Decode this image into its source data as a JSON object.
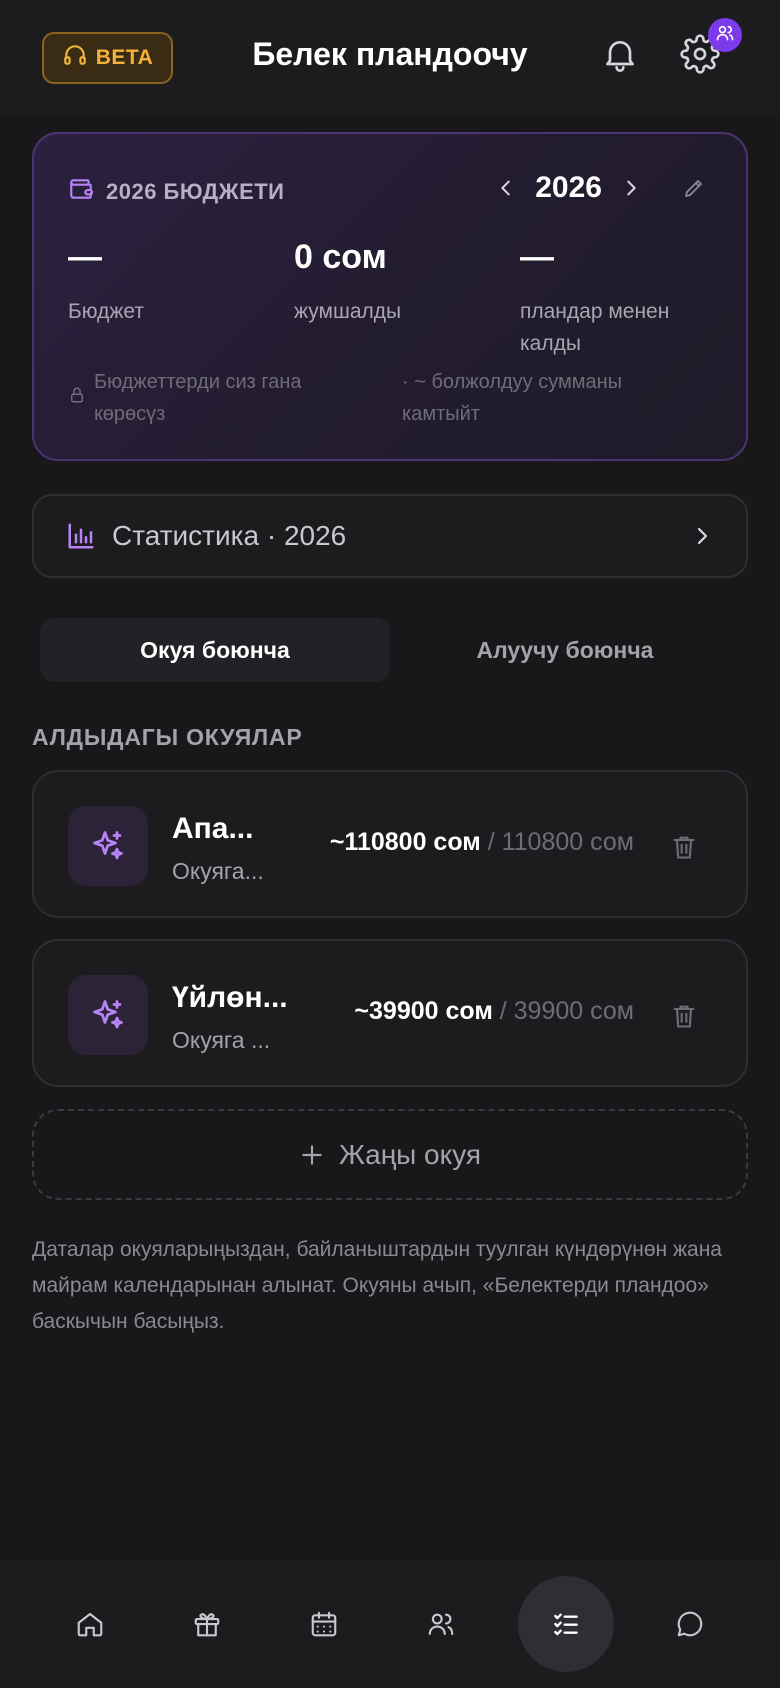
{
  "header": {
    "beta_label": "BETA",
    "title": "Белек пландоочу",
    "icons": [
      "headphones-icon",
      "bell-icon",
      "gear-icon",
      "users-icon"
    ]
  },
  "budget": {
    "heading": "2026 БЮДЖЕТИ",
    "year": "2026",
    "stats": [
      {
        "value": "—",
        "label": "Бюджет"
      },
      {
        "value": "0 сом",
        "label": "жумшалды"
      },
      {
        "value": "—",
        "label": "пландар менен калды"
      }
    ],
    "note_private": "Бюджеттерди сиз гана көрөсүз",
    "note_approx": "· ~ болжолдуу сумманы камтыйт"
  },
  "statistics": {
    "label": "Статистика · 2026"
  },
  "tabs": {
    "by_event": "Окуя боюнча",
    "by_recipient": "Алуучу боюнча"
  },
  "section_title": "АЛДЫДАГЫ ОКУЯЛАР",
  "events": [
    {
      "name": "Апа...",
      "subtitle": "Окуяга...",
      "planned": "~110800 сом",
      "separator": " / ",
      "total": "110800 сом"
    },
    {
      "name": "Үйлөн...",
      "subtitle": "Окуяга ...",
      "planned": "~39900 сом",
      "separator": " / ",
      "total": "39900 сом"
    }
  ],
  "new_event_label": "Жаңы окуя",
  "info_text": "Даталар окуяларыңыздан, байланыштардын туулган күндөрүнөн жана майрам календарынан алынат. Окуяны ачып, «Белектерди пландоо» баскычын басыңыз.",
  "colors": {
    "accent": "#7c3aed",
    "beta": "#f3b23d",
    "background": "#18181b",
    "card": "#1c1c1f",
    "purple_icon": "#b784f5"
  },
  "bottom_nav": [
    "home-icon",
    "gift-icon",
    "calendar-icon",
    "contacts-icon",
    "checklist-icon",
    "chat-icon"
  ]
}
